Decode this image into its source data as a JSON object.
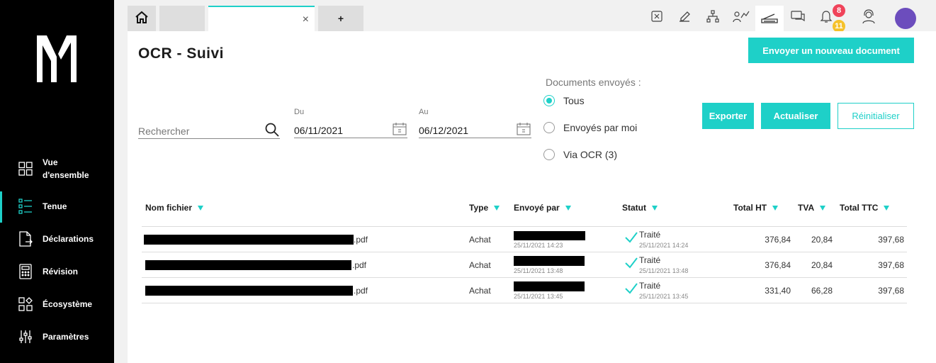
{
  "sidebar": {
    "logo": "M",
    "items": [
      {
        "label": "Vue\nd'ensemble",
        "icon": "grid-icon"
      },
      {
        "label": "Tenue",
        "icon": "checklist-icon"
      },
      {
        "label": "Déclarations",
        "icon": "document-arrow-icon"
      },
      {
        "label": "Révision",
        "icon": "calculator-icon"
      },
      {
        "label": "Écosystème",
        "icon": "ecosystem-icon"
      },
      {
        "label": "Paramètres",
        "icon": "sliders-icon"
      }
    ],
    "active_index": 1
  },
  "tabs": {
    "home_icon": "home-icon",
    "close_glyph": "×",
    "add_label": "+"
  },
  "topbar": {
    "icons": [
      "calculator-keypad-icon",
      "edit-icon",
      "network-icon",
      "chart-people-icon",
      "scanner-icon",
      "chat-icon",
      "bell-icon",
      "support-agent-icon"
    ],
    "badges": {
      "notifications_red": "8",
      "notifications_yellow": "11"
    },
    "colors": {
      "red": "#f0435a",
      "yellow": "#f5c12a",
      "avatar": "#6c4dbd"
    }
  },
  "page": {
    "title": "OCR - Suivi",
    "new_doc_button": "Envoyer un nouveau document",
    "export_button": "Exporter",
    "refresh_button": "Actualiser",
    "reset_button": "Réinitialiser"
  },
  "filters": {
    "search_placeholder": "Rechercher",
    "from_label": "Du",
    "from_value": "06/11/2021",
    "to_label": "Au",
    "to_value": "06/12/2021",
    "sent_title": "Documents envoyés :",
    "radios": [
      {
        "label": "Tous",
        "checked": true
      },
      {
        "label": "Envoyés par moi",
        "checked": false
      },
      {
        "label": "Via OCR (3)",
        "checked": false
      }
    ]
  },
  "table": {
    "headers": {
      "filename": "Nom fichier",
      "type": "Type",
      "sent_by": "Envoyé par",
      "status": "Statut",
      "total_ht": "Total HT",
      "tva": "TVA",
      "total_ttc": "Total TTC"
    },
    "rows": [
      {
        "ext": ".pdf",
        "type": "Achat",
        "sent_date": "25/11/2021 14:23",
        "status": "Traité",
        "status_date": "25/11/2021 14:24",
        "total_ht": "376,84",
        "tva": "20,84",
        "total_ttc": "397,68"
      },
      {
        "ext": ".pdf",
        "type": "Achat",
        "sent_date": "25/11/2021 13:48",
        "status": "Traité",
        "status_date": "25/11/2021 13:48",
        "total_ht": "376,84",
        "tva": "20,84",
        "total_ttc": "397,68"
      },
      {
        "ext": ".pdf",
        "type": "Achat",
        "sent_date": "25/11/2021 13:45",
        "status": "Traité",
        "status_date": "25/11/2021 13:45",
        "total_ht": "331,40",
        "tva": "66,28",
        "total_ttc": "397,68"
      }
    ]
  },
  "colors": {
    "accent": "#1ed0c8",
    "sidebar_bg": "#000000"
  }
}
